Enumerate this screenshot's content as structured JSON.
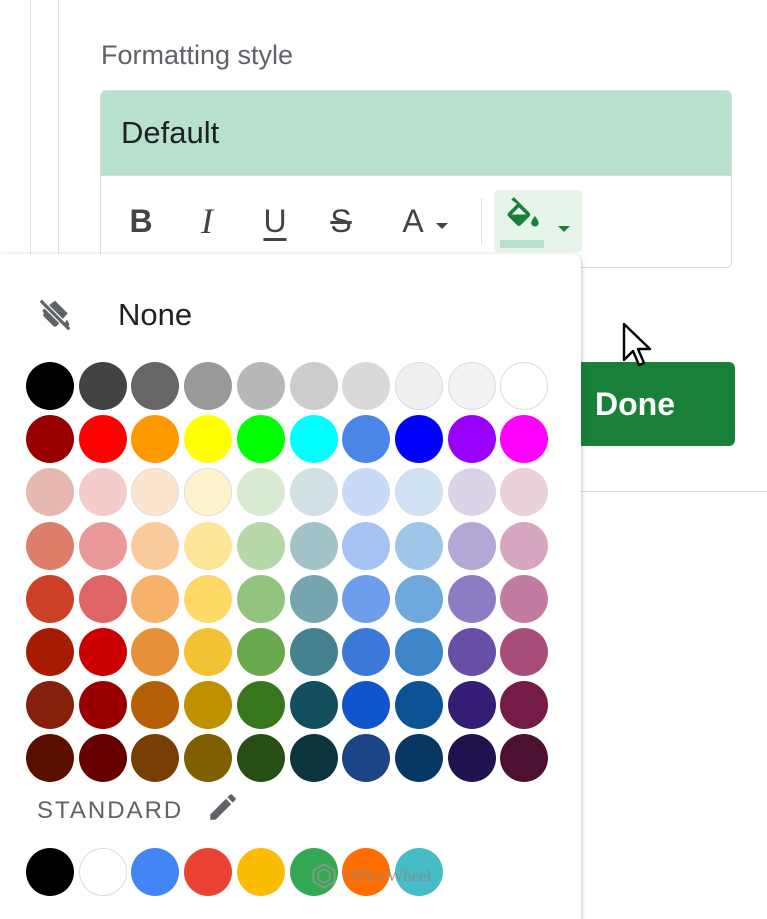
{
  "formatting": {
    "label": "Formatting style",
    "preview_text": "Default"
  },
  "toolbar": {
    "bold": "B",
    "italic": "I",
    "underline": "U",
    "strikethrough": "S",
    "text_color": "A"
  },
  "done_label": "Done",
  "palette": {
    "none_label": "None",
    "standard_label": "STANDARD",
    "grid": [
      [
        "#000000",
        "#434343",
        "#666666",
        "#999999",
        "#b7b7b7",
        "#cccccc",
        "#d9d9d9",
        "#efefef",
        "#f3f3f3",
        "#ffffff"
      ],
      [
        "#980000",
        "#ff0000",
        "#ff9900",
        "#ffff00",
        "#00ff00",
        "#00ffff",
        "#4a86e8",
        "#0000ff",
        "#9900ff",
        "#ff00ff"
      ],
      [
        "#e6b8af",
        "#f4cccc",
        "#fce5cd",
        "#fff2cc",
        "#d9ead3",
        "#d0e0e3",
        "#c9daf8",
        "#cfe2f3",
        "#d9d2e9",
        "#ead1dc"
      ],
      [
        "#dd7e6b",
        "#ea9999",
        "#f9cb9c",
        "#ffe599",
        "#b6d7a8",
        "#a2c4c9",
        "#a4c2f4",
        "#9fc5e8",
        "#b4a7d6",
        "#d5a6bd"
      ],
      [
        "#cc4125",
        "#e06666",
        "#f6b26b",
        "#ffd966",
        "#93c47d",
        "#76a5af",
        "#6d9eeb",
        "#6fa8dc",
        "#8e7cc3",
        "#c27ba0"
      ],
      [
        "#a61c00",
        "#cc0000",
        "#e69138",
        "#f1c232",
        "#6aa84f",
        "#45818e",
        "#3c78d8",
        "#3d85c6",
        "#674ea7",
        "#a64d79"
      ],
      [
        "#85200c",
        "#990000",
        "#b45f06",
        "#bf9000",
        "#38761d",
        "#134f5c",
        "#1155cc",
        "#0b5394",
        "#351c75",
        "#741b47"
      ],
      [
        "#5b0f00",
        "#660000",
        "#783f04",
        "#7f6000",
        "#274e13",
        "#0c343d",
        "#1c4587",
        "#073763",
        "#20124d",
        "#4c1130"
      ]
    ],
    "standard": [
      "#000000",
      "#ffffff",
      "#4285f4",
      "#ea4335",
      "#fbbc04",
      "#34a853",
      "#ff6d01",
      "#46bdc6"
    ]
  },
  "watermark": "OfficeWheel"
}
